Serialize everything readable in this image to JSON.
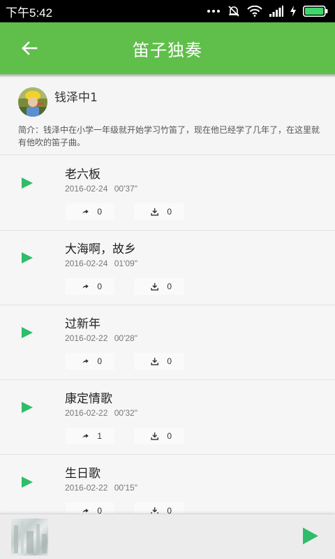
{
  "status_bar": {
    "time": "下午5:42",
    "icons": [
      "dots-icon",
      "mute-icon",
      "wifi-icon",
      "signal-icon",
      "charging-icon",
      "battery-icon"
    ]
  },
  "app_bar": {
    "title": "笛子独奏",
    "back_icon": "arrow-left-icon"
  },
  "author": {
    "name": "钱泽中1",
    "intro": "简介：钱泽中在小学一年级就开始学习竹笛了，现在他已经学了几年了，在这里就有他吹的笛子曲。"
  },
  "tracks": [
    {
      "title": "老六板",
      "date": "2016-02-24",
      "duration": "00'37\"",
      "shares": "0",
      "downloads": "0"
    },
    {
      "title": "大海啊，故乡",
      "date": "2016-02-24",
      "duration": "01'09\"",
      "shares": "0",
      "downloads": "0"
    },
    {
      "title": "过新年",
      "date": "2016-02-22",
      "duration": "00'28\"",
      "shares": "0",
      "downloads": "0"
    },
    {
      "title": "康定情歌",
      "date": "2016-02-22",
      "duration": "00'32\"",
      "shares": "1",
      "downloads": "0"
    },
    {
      "title": "生日歌",
      "date": "2016-02-22",
      "duration": "00'15\"",
      "shares": "0",
      "downloads": "0"
    }
  ],
  "colors": {
    "accent": "#60be4b",
    "play": "#2ebd6b"
  }
}
